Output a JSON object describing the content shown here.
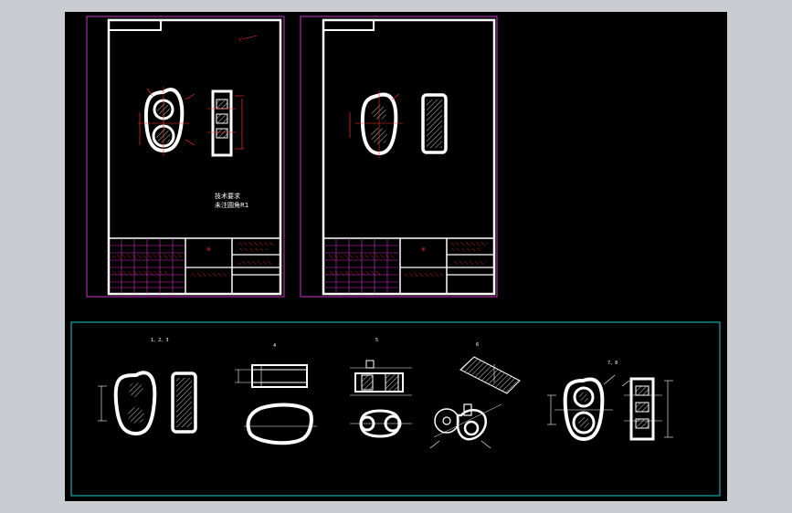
{
  "sheets": [
    {
      "notes": [
        "技术要求",
        "未注圆角R1"
      ],
      "title_block_mark": "※"
    },
    {
      "title_block_mark": "※"
    }
  ],
  "strip_labels": [
    "1、2、3",
    "4",
    "5",
    "6",
    "7、8"
  ],
  "colors": {
    "background": "#000000",
    "outer": "#c9cdd2",
    "sheet_frame": "#cc33cc",
    "strip_frame": "#22cccc",
    "drawing": "#ffffff",
    "dimension": "#ff3030",
    "hatch": "#ffffff"
  }
}
